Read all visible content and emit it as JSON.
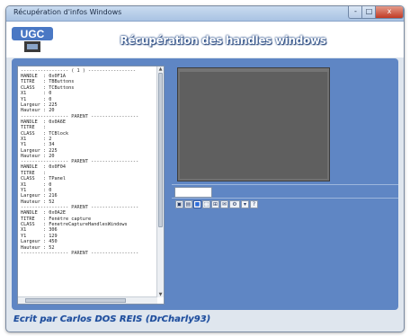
{
  "window": {
    "title": "Récupération d'infos Windows",
    "minimize_label": "-",
    "maximize_label": "□",
    "close_label": "x"
  },
  "header": {
    "logo_text": "UGC",
    "title": "Récupération des handles windows"
  },
  "list": {
    "separators": [
      "----------------- ( 1 ) -----------------",
      "----------------- PARENT -----------------",
      "----------------- PARENT -----------------",
      "----------------- PARENT -----------------",
      "----------------- PARENT -----------------"
    ],
    "entries": [
      "HANDLE  : 0x0F1A",
      "TITRE   : TBButtons",
      "CLASS   : TCButtons",
      "X1      : 0",
      "Y1      : 0",
      "Largeur : 225",
      "Hauteur : 20",
      "HANDLE  : 0x0A6E",
      "TITRE   : ",
      "CLASS   : TCBlock",
      "X1      : 2",
      "Y1      : 34",
      "Largeur : 225",
      "Hauteur : 20",
      "HANDLE  : 0x0F04",
      "TITRE   : ",
      "CLASS   : TPanel",
      "X1      : 0",
      "Y1      : 0",
      "Largeur : 216",
      "Hauteur : 52",
      "HANDLE  : 0x0A2E",
      "TITRE   : Fenêtre capture",
      "CLASS   : FenetreCaptureHandlesWindows",
      "X1      : 306",
      "Y1      : 129",
      "Largeur : 450",
      "Hauteur : 52"
    ],
    "scroll_up": "▲",
    "scroll_down": "▼"
  },
  "field": {
    "value": ""
  },
  "toolbar": {
    "items": [
      "▣",
      "▤",
      "■",
      "⬚",
      "⊞",
      "✉",
      "⚙",
      "▾",
      "?"
    ]
  },
  "footer": {
    "text": "Ecrit par Carlos DOS REIS (DrCharly93)"
  }
}
